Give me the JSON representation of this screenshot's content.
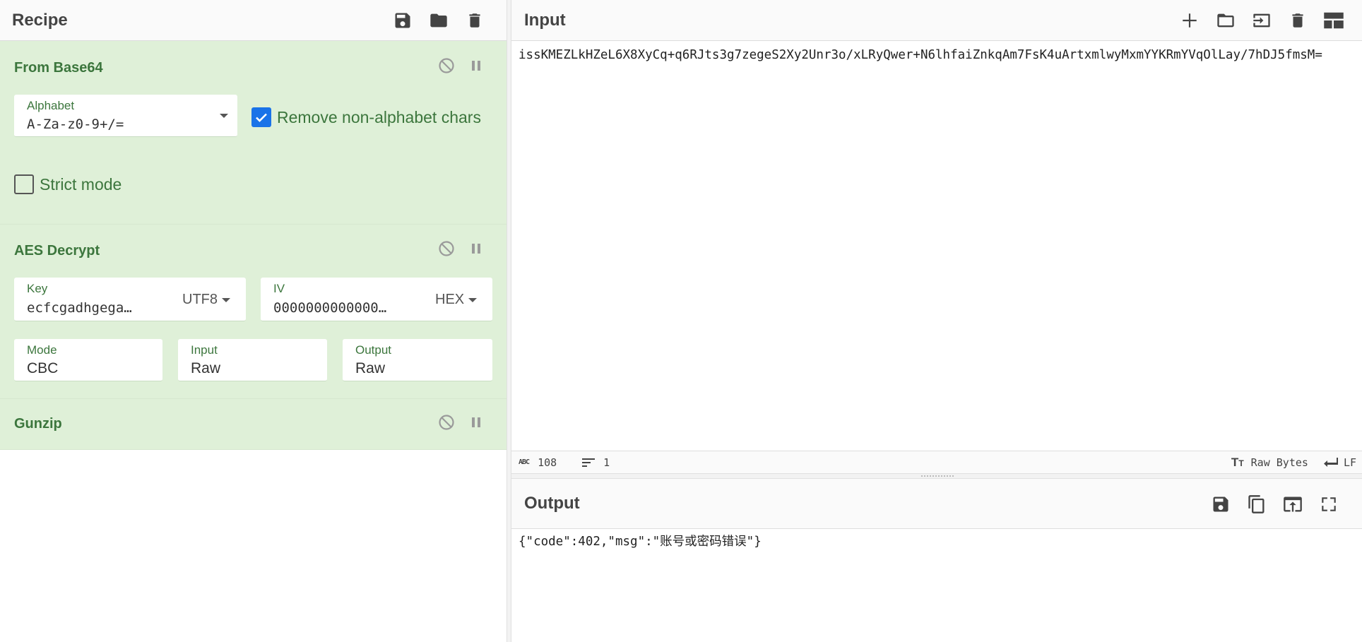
{
  "recipe": {
    "title": "Recipe",
    "icons": [
      "save-icon",
      "folder-open-icon",
      "trash-icon"
    ],
    "operations": [
      {
        "name": "From Base64",
        "alphabet_label": "Alphabet",
        "alphabet_value": "A-Za-z0-9+/=",
        "remove_nonalpha_label": "Remove non-alphabet chars",
        "remove_nonalpha_checked": true,
        "strict_label": "Strict mode",
        "strict_checked": false
      },
      {
        "name": "AES Decrypt",
        "key_label": "Key",
        "key_value": "ecfcgadhgega…",
        "key_encoding": "UTF8",
        "iv_label": "IV",
        "iv_value": "0000000000000…",
        "iv_encoding": "HEX",
        "mode_label": "Mode",
        "mode_value": "CBC",
        "input_label": "Input",
        "input_value": "Raw",
        "output_label": "Output",
        "output_value": "Raw"
      },
      {
        "name": "Gunzip"
      }
    ]
  },
  "input": {
    "title": "Input",
    "icons": [
      "plus-icon",
      "folder-icon",
      "sign-in-icon",
      "trash-icon",
      "layout-icon"
    ],
    "text": "issKMEZLkHZeL6X8XyCq+q6RJts3g7zegeS2Xy2Unr3o/xLRyQwer+N6lhfaiZnkqAm7FsK4uArtxmlwyMxmYYKRmYVqOlLay/7hDJ5fmsM=",
    "status": {
      "length_icon": "abc-icon",
      "length": "108",
      "lines_icon": "lines-icon",
      "lines": "1",
      "encoding_icon": "text-size-icon",
      "encoding": "Raw Bytes",
      "eol_icon": "return-icon",
      "eol": "LF"
    }
  },
  "output": {
    "title": "Output",
    "icons": [
      "save-icon",
      "copy-icon",
      "replace-input-icon",
      "maximize-icon"
    ],
    "text": "{\"code\":402,\"msg\":\"账号或密码错误\"}"
  },
  "colors": {
    "op_bg": "#dff0d8",
    "op_text": "#3c763d",
    "checkbox_on": "#1a73e8"
  }
}
